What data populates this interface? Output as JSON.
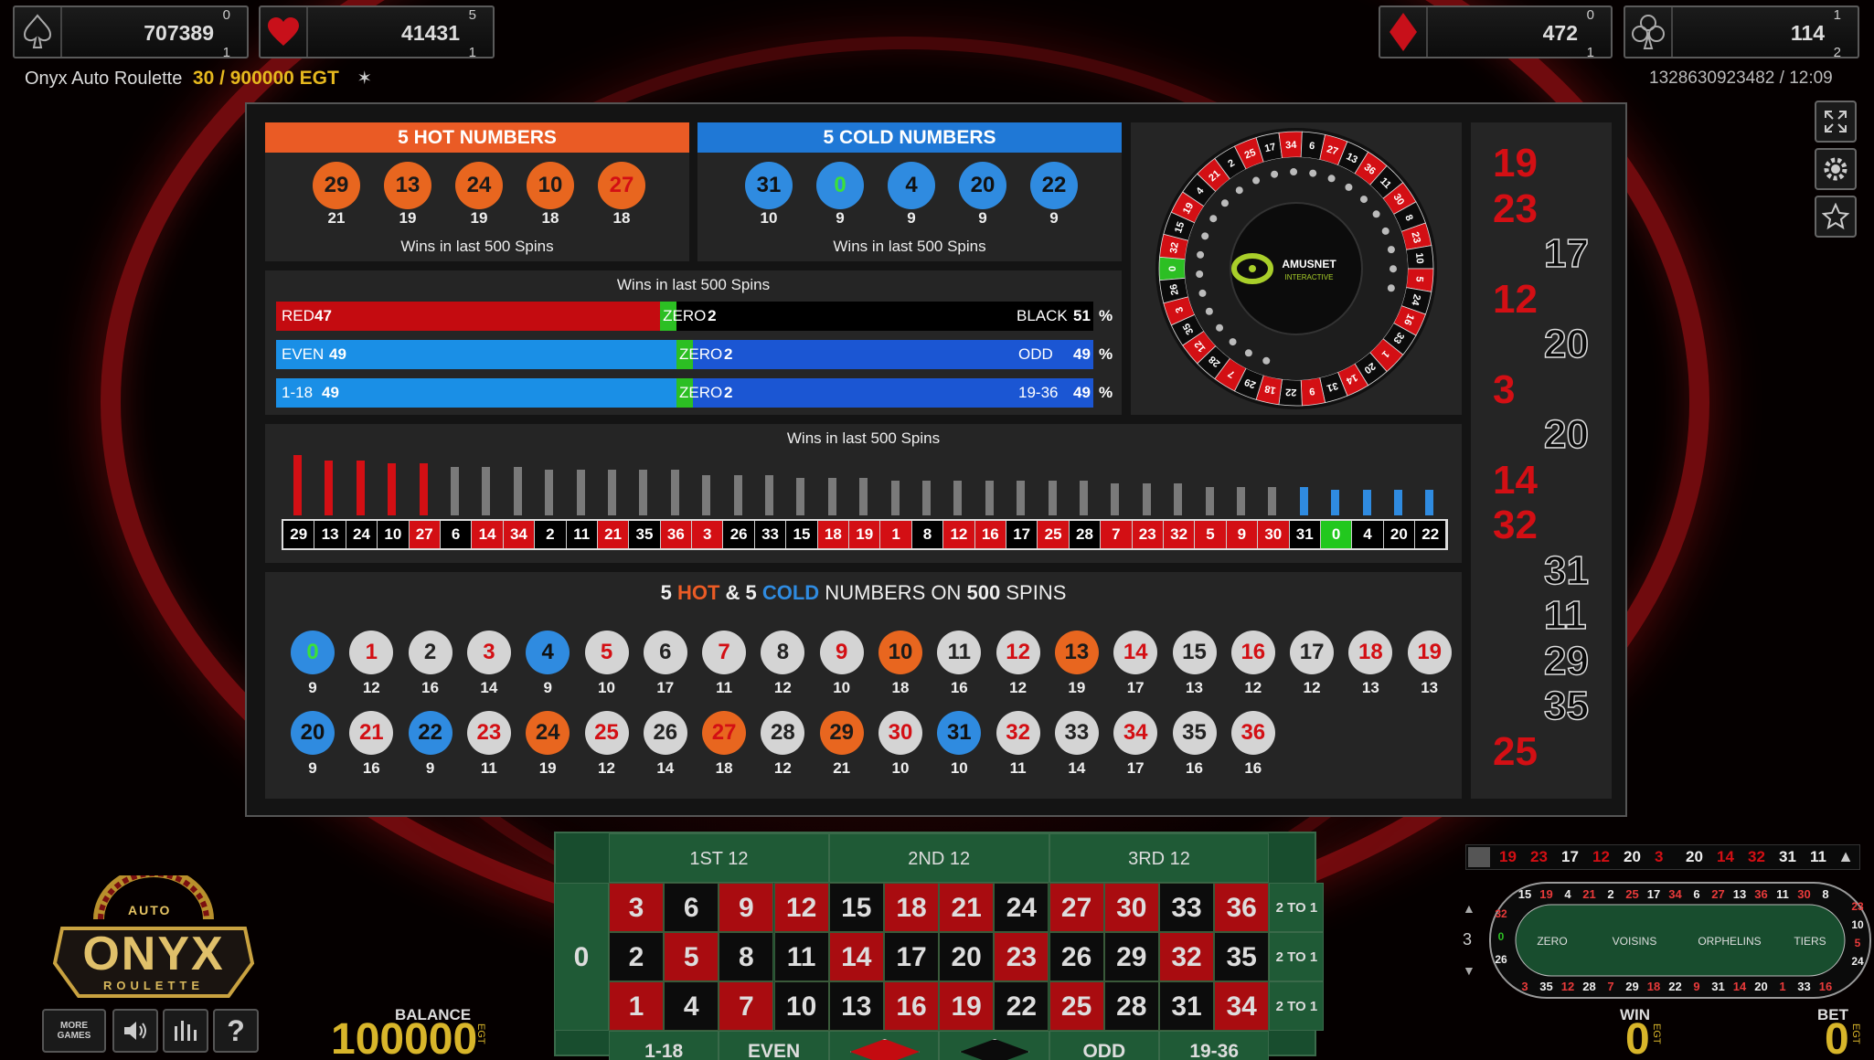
{
  "top": {
    "spade": {
      "value": "707389",
      "small_top": "0",
      "small_bottom": "1"
    },
    "heart": {
      "value": "41431",
      "small_top": "5",
      "small_bottom": "1"
    },
    "diamond": {
      "value": "472",
      "small_top": "0",
      "small_bottom": "1"
    },
    "club": {
      "value": "114",
      "small_top": "1",
      "small_bottom": "2"
    },
    "game_name": "Onyx Auto Roulette",
    "limits": "30 / 900000 EGT",
    "round_time": "1328630923482 / 12:09"
  },
  "hot": {
    "title": "5 HOT NUMBERS",
    "caption": "Wins in last 500 Spins",
    "balls": [
      {
        "n": "29",
        "c": "21"
      },
      {
        "n": "13",
        "c": "19"
      },
      {
        "n": "24",
        "c": "19"
      },
      {
        "n": "10",
        "c": "18"
      },
      {
        "n": "27",
        "c": "18"
      }
    ]
  },
  "cold": {
    "title": "5 COLD NUMBERS",
    "caption": "Wins in last 500 Spins",
    "balls": [
      {
        "n": "31",
        "c": "10"
      },
      {
        "n": "0",
        "c": "9"
      },
      {
        "n": "4",
        "c": "9"
      },
      {
        "n": "20",
        "c": "9"
      },
      {
        "n": "22",
        "c": "9"
      }
    ]
  },
  "ratios": {
    "caption": "Wins in last 500 Spins",
    "pct": "%",
    "rows": [
      {
        "left": "RED",
        "lv": "47",
        "mid": "ZERO",
        "mv": "2",
        "right": "BLACK",
        "rv": "51"
      },
      {
        "left": "EVEN",
        "lv": "49",
        "mid": "ZERO",
        "mv": "2",
        "right": "ODD",
        "rv": "49"
      },
      {
        "left": "1-18",
        "lv": "49",
        "mid": "ZERO",
        "mv": "2",
        "right": "19-36",
        "rv": "49"
      }
    ]
  },
  "wheel_logo": {
    "line1": "AMUSNET",
    "line2": "INTERACTIVE"
  },
  "freq": {
    "caption": "Wins in last 500 Spins",
    "numbers": [
      "29",
      "13",
      "24",
      "10",
      "27",
      "6",
      "14",
      "34",
      "2",
      "11",
      "21",
      "35",
      "36",
      "3",
      "26",
      "33",
      "15",
      "18",
      "19",
      "1",
      "8",
      "12",
      "16",
      "17",
      "25",
      "28",
      "7",
      "23",
      "32",
      "5",
      "9",
      "30",
      "31",
      "0",
      "4",
      "20",
      "22"
    ],
    "counts": [
      21,
      19,
      19,
      18,
      18,
      17,
      17,
      17,
      16,
      16,
      16,
      16,
      16,
      14,
      14,
      14,
      13,
      13,
      13,
      12,
      12,
      12,
      12,
      12,
      12,
      12,
      11,
      11,
      11,
      10,
      10,
      10,
      10,
      9,
      9,
      9,
      9
    ]
  },
  "grid": {
    "t1": "5 ",
    "t2": "HOT",
    "t3": " & 5 ",
    "t4": "COLD",
    "t5": " NUMBERS ON ",
    "t6": "500",
    "t7": " SPINS",
    "balls": [
      {
        "n": "0",
        "c": "9"
      },
      {
        "n": "1",
        "c": "12"
      },
      {
        "n": "2",
        "c": "16"
      },
      {
        "n": "3",
        "c": "14"
      },
      {
        "n": "4",
        "c": "9"
      },
      {
        "n": "5",
        "c": "10"
      },
      {
        "n": "6",
        "c": "17"
      },
      {
        "n": "7",
        "c": "11"
      },
      {
        "n": "8",
        "c": "12"
      },
      {
        "n": "9",
        "c": "10"
      },
      {
        "n": "10",
        "c": "18"
      },
      {
        "n": "11",
        "c": "16"
      },
      {
        "n": "12",
        "c": "12"
      },
      {
        "n": "13",
        "c": "19"
      },
      {
        "n": "14",
        "c": "17"
      },
      {
        "n": "15",
        "c": "13"
      },
      {
        "n": "16",
        "c": "12"
      },
      {
        "n": "17",
        "c": "12"
      },
      {
        "n": "18",
        "c": "13"
      },
      {
        "n": "19",
        "c": "13"
      },
      {
        "n": "20",
        "c": "9"
      },
      {
        "n": "21",
        "c": "16"
      },
      {
        "n": "22",
        "c": "9"
      },
      {
        "n": "23",
        "c": "11"
      },
      {
        "n": "24",
        "c": "19"
      },
      {
        "n": "25",
        "c": "12"
      },
      {
        "n": "26",
        "c": "14"
      },
      {
        "n": "27",
        "c": "18"
      },
      {
        "n": "28",
        "c": "12"
      },
      {
        "n": "29",
        "c": "21"
      },
      {
        "n": "30",
        "c": "10"
      },
      {
        "n": "31",
        "c": "10"
      },
      {
        "n": "32",
        "c": "11"
      },
      {
        "n": "33",
        "c": "14"
      },
      {
        "n": "34",
        "c": "17"
      },
      {
        "n": "35",
        "c": "16"
      },
      {
        "n": "36",
        "c": "16"
      }
    ]
  },
  "history": [
    "19",
    "23",
    "17",
    "12",
    "20",
    "3",
    "20",
    "14",
    "32",
    "31",
    "11",
    "29",
    "35",
    "25"
  ],
  "table": {
    "dozens": [
      "1ST 12",
      "2ND 12",
      "3RD 12"
    ],
    "zero": "0",
    "col": "2 TO 1",
    "bottom": [
      "1-18",
      "EVEN",
      "",
      "",
      "ODD",
      "19-36"
    ]
  },
  "mini_history": [
    "19",
    "23",
    "17",
    "12",
    "20",
    "3",
    "20",
    "14",
    "32",
    "31",
    "11"
  ],
  "race": {
    "zone": [
      "ZERO",
      "VOISINS",
      "ORPHELINS",
      "TIERS"
    ],
    "num": "3",
    "top": [
      "15",
      "19",
      "4",
      "21",
      "2",
      "25",
      "17",
      "34",
      "6",
      "27",
      "13",
      "36",
      "11",
      "30",
      "8"
    ],
    "bot": [
      "3",
      "35",
      "12",
      "28",
      "7",
      "29",
      "18",
      "22",
      "9",
      "31",
      "14",
      "20",
      "1",
      "33",
      "16"
    ],
    "left": [
      "32",
      "0",
      "26"
    ],
    "right": [
      "23",
      "10",
      "5",
      "24"
    ]
  },
  "logo": {
    "auto": "AUTO",
    "onyx": "ONYX",
    "roulette": "ROULETTE"
  },
  "buttons": {
    "more": "MORE GAMES",
    "help": "?"
  },
  "balance": {
    "label": "BALANCE",
    "value": "100000",
    "cur": "EGT"
  },
  "win": {
    "label": "WIN",
    "value": "0",
    "cur": "EGT"
  },
  "bet": {
    "label": "BET",
    "value": "0",
    "cur": "EGT"
  },
  "colors": {
    "hot": "#e85d26",
    "cold": "#2f8be0",
    "red": "#d30f14",
    "green": "#22c81e"
  }
}
